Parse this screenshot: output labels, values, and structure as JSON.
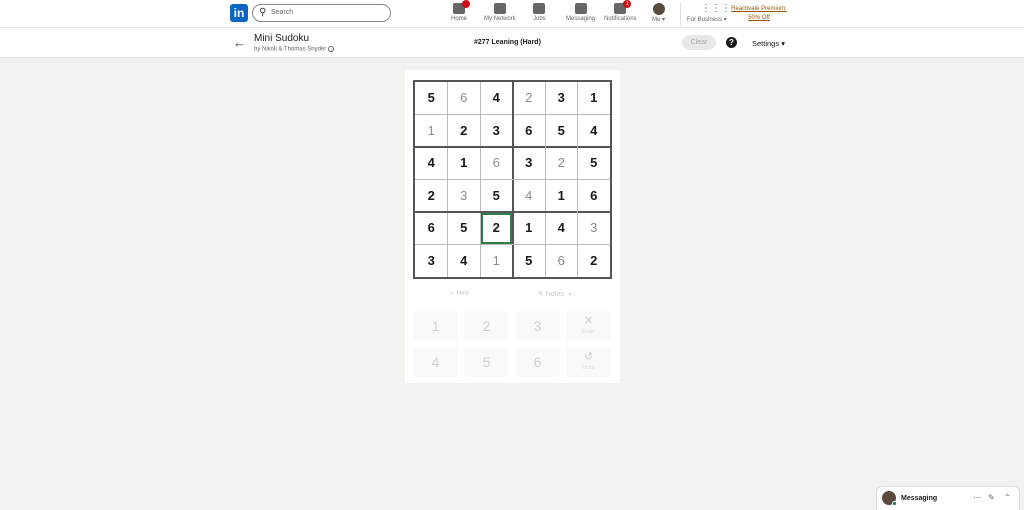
{
  "nav": {
    "search_placeholder": "Search",
    "items": [
      {
        "label": "Home",
        "icon": "home-icon",
        "badge": ""
      },
      {
        "label": "My Network",
        "icon": "network-icon",
        "badge": ""
      },
      {
        "label": "Jobs",
        "icon": "jobs-icon",
        "badge": ""
      },
      {
        "label": "Messaging",
        "icon": "messaging-icon",
        "badge": ""
      },
      {
        "label": "Notifications",
        "icon": "bell-icon",
        "badge": "1"
      }
    ],
    "me_label": "Me",
    "business_label": "For Business",
    "premium_line1": "Reactivate Premium:",
    "premium_line2": "50% Off"
  },
  "header": {
    "title": "Mini Sudoku",
    "author": "by Nikoli & Thomas Snyder",
    "puzzle_id": "#277 Leaning (Hard)",
    "clear_label": "Clear",
    "help_label": "?",
    "settings_label": "Settings"
  },
  "board": {
    "values": [
      [
        5,
        6,
        4,
        2,
        3,
        1
      ],
      [
        1,
        2,
        3,
        6,
        5,
        4
      ],
      [
        4,
        1,
        6,
        3,
        2,
        5
      ],
      [
        2,
        3,
        5,
        4,
        1,
        6
      ],
      [
        6,
        5,
        2,
        1,
        4,
        3
      ],
      [
        3,
        4,
        1,
        5,
        6,
        2
      ]
    ],
    "given": [
      [
        1,
        0,
        1,
        0,
        1,
        1
      ],
      [
        0,
        1,
        1,
        1,
        1,
        1
      ],
      [
        1,
        1,
        0,
        1,
        0,
        1
      ],
      [
        1,
        0,
        1,
        0,
        1,
        1
      ],
      [
        1,
        1,
        1,
        1,
        1,
        0
      ],
      [
        1,
        1,
        0,
        1,
        0,
        1
      ]
    ],
    "selected_row": 4,
    "selected_col": 2
  },
  "controls": {
    "hint_label": "Hint",
    "notes_label": "Notes",
    "keypad": [
      "1",
      "2",
      "3",
      "4",
      "5",
      "6"
    ],
    "erase_label": "Erase",
    "undo_label": "Undo"
  },
  "messaging": {
    "label": "Messaging"
  }
}
